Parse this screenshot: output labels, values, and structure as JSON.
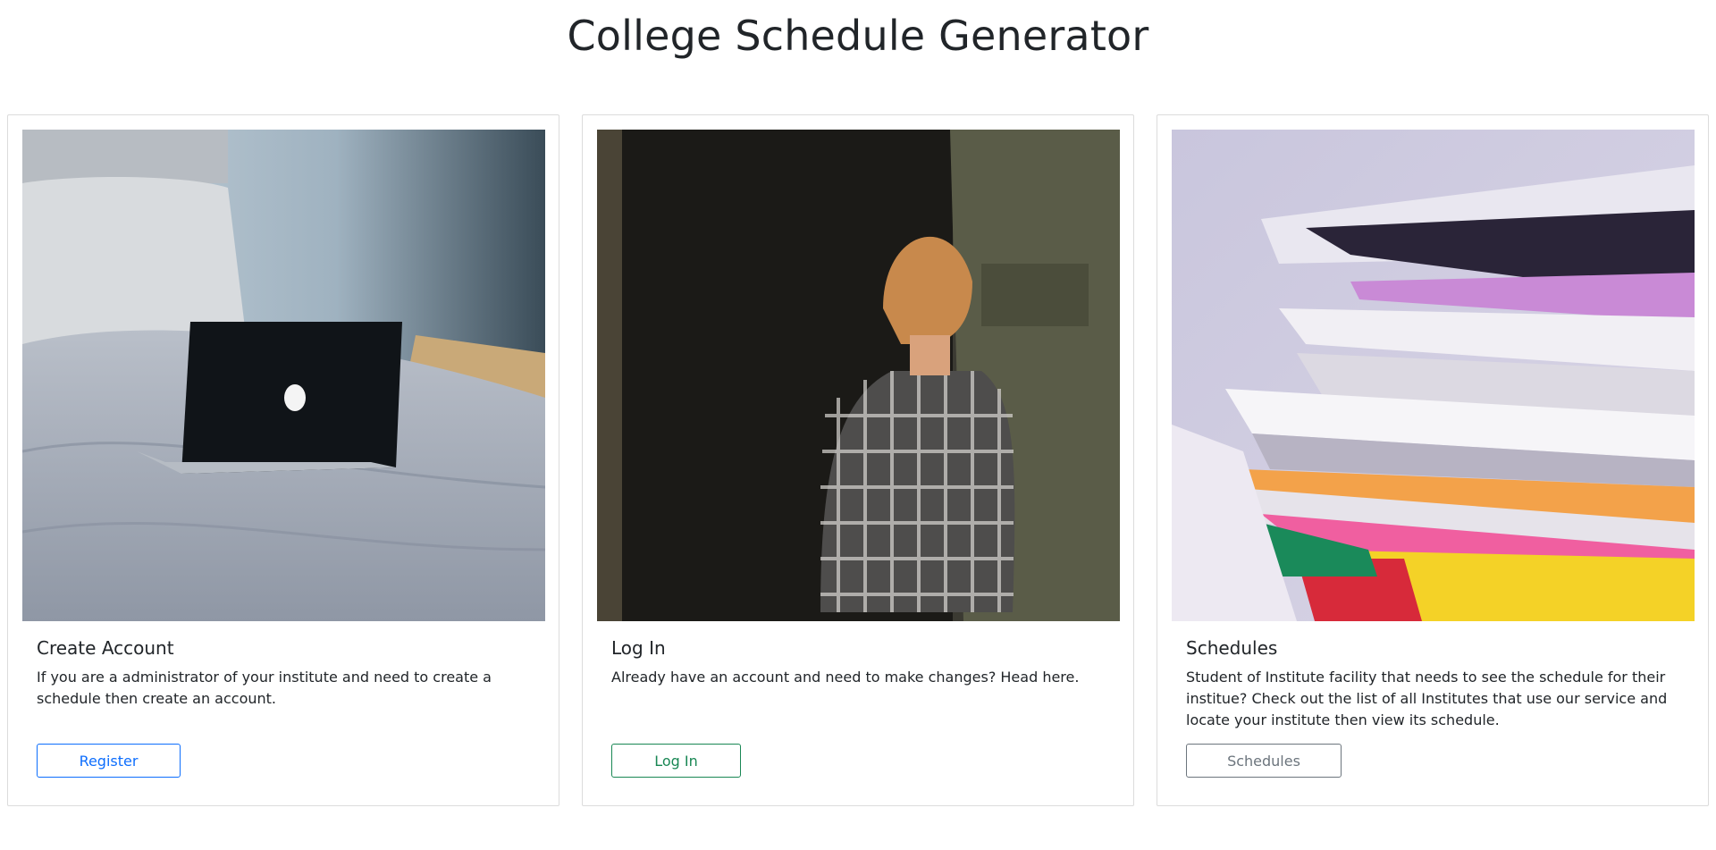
{
  "page": {
    "title": "College Schedule Generator"
  },
  "cards": [
    {
      "image": "laptop-on-bed",
      "title": "Create Account",
      "text": "If you are a administrator of your institute and need to create a schedule then create an account.",
      "button": {
        "label": "Register",
        "color": "#0d6efd"
      }
    },
    {
      "image": "person-entering-door",
      "title": "Log In",
      "text": "Already have an account and need to make changes? Head here.",
      "button": {
        "label": "Log In",
        "color": "#198754"
      }
    },
    {
      "image": "stack-of-papers",
      "title": "Schedules",
      "text": "Student of Institute facility that needs to see the schedule for their institue? Check out the list of all Institutes that use our service and locate your institute then view its schedule.",
      "button": {
        "label": "Schedules",
        "color": "#6c757d"
      }
    }
  ]
}
